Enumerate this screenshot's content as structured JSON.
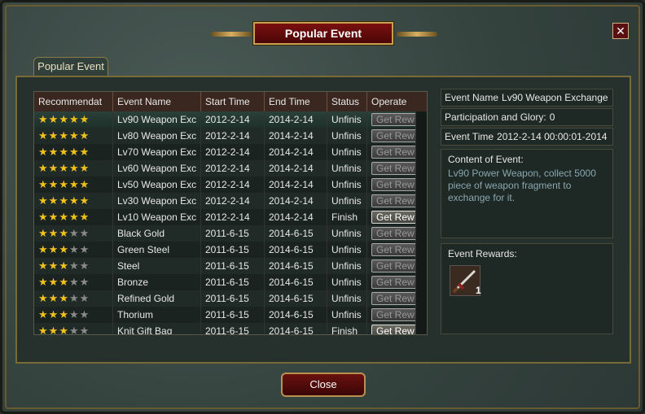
{
  "window": {
    "title": "Popular Event",
    "close_glyph": "✕"
  },
  "tab": {
    "label": "Popular Event"
  },
  "table": {
    "headers": [
      "Recommendat",
      "Event Name",
      "Start Time",
      "End Time",
      "Status",
      "Operate"
    ],
    "rows": [
      {
        "stars": 5,
        "name": "Lv90 Weapon Exc",
        "start": "2012-2-14",
        "end": "2014-2-14",
        "status": "Unfinis",
        "operate": "Get Rew",
        "active": false
      },
      {
        "stars": 5,
        "name": "Lv80 Weapon Exc",
        "start": "2012-2-14",
        "end": "2014-2-14",
        "status": "Unfinis",
        "operate": "Get Rew",
        "active": false
      },
      {
        "stars": 5,
        "name": "Lv70 Weapon Exc",
        "start": "2012-2-14",
        "end": "2014-2-14",
        "status": "Unfinis",
        "operate": "Get Rew",
        "active": false
      },
      {
        "stars": 5,
        "name": "Lv60 Weapon Exc",
        "start": "2012-2-14",
        "end": "2014-2-14",
        "status": "Unfinis",
        "operate": "Get Rew",
        "active": false
      },
      {
        "stars": 5,
        "name": "Lv50 Weapon Exc",
        "start": "2012-2-14",
        "end": "2014-2-14",
        "status": "Unfinis",
        "operate": "Get Rew",
        "active": false
      },
      {
        "stars": 5,
        "name": "Lv30 Weapon Exc",
        "start": "2012-2-14",
        "end": "2014-2-14",
        "status": "Unfinis",
        "operate": "Get Rew",
        "active": false
      },
      {
        "stars": 5,
        "name": "Lv10 Weapon Exc",
        "start": "2012-2-14",
        "end": "2014-2-14",
        "status": "Finish",
        "operate": "Get Rew",
        "active": true
      },
      {
        "stars": 3,
        "name": "Black Gold",
        "start": "2011-6-15",
        "end": "2014-6-15",
        "status": "Unfinis",
        "operate": "Get Rew",
        "active": false
      },
      {
        "stars": 3,
        "name": "Green Steel",
        "start": "2011-6-15",
        "end": "2014-6-15",
        "status": "Unfinis",
        "operate": "Get Rew",
        "active": false
      },
      {
        "stars": 3,
        "name": "Steel",
        "start": "2011-6-15",
        "end": "2014-6-15",
        "status": "Unfinis",
        "operate": "Get Rew",
        "active": false
      },
      {
        "stars": 3,
        "name": "Bronze",
        "start": "2011-6-15",
        "end": "2014-6-15",
        "status": "Unfinis",
        "operate": "Get Rew",
        "active": false
      },
      {
        "stars": 3,
        "name": "Refined Gold",
        "start": "2011-6-15",
        "end": "2014-6-15",
        "status": "Unfinis",
        "operate": "Get Rew",
        "active": false
      },
      {
        "stars": 3,
        "name": "Thorium",
        "start": "2011-6-15",
        "end": "2014-6-15",
        "status": "Unfinis",
        "operate": "Get Rew",
        "active": false
      },
      {
        "stars": 3,
        "name": "Knit Gift Bag",
        "start": "2011-6-15",
        "end": "2014-6-15",
        "status": "Finish",
        "operate": "Get Rew",
        "active": true
      }
    ]
  },
  "detail": {
    "name_label": "Event Name",
    "name_value": "Lv90 Weapon Exchange",
    "glory_label": "Participation and Glory:",
    "glory_value": "0",
    "time_label": "Event Time",
    "time_value": "2012-2-14 00:00:01-2014",
    "content_label": "Content of Event:",
    "content_text": "Lv90 Power Weapon, collect 5000 piece of weapon fragment to exchange for it.",
    "rewards_label": "Event Rewards:",
    "reward_count": "1",
    "reward_icon": "weapon-icon"
  },
  "footer": {
    "close_label": "Close"
  }
}
